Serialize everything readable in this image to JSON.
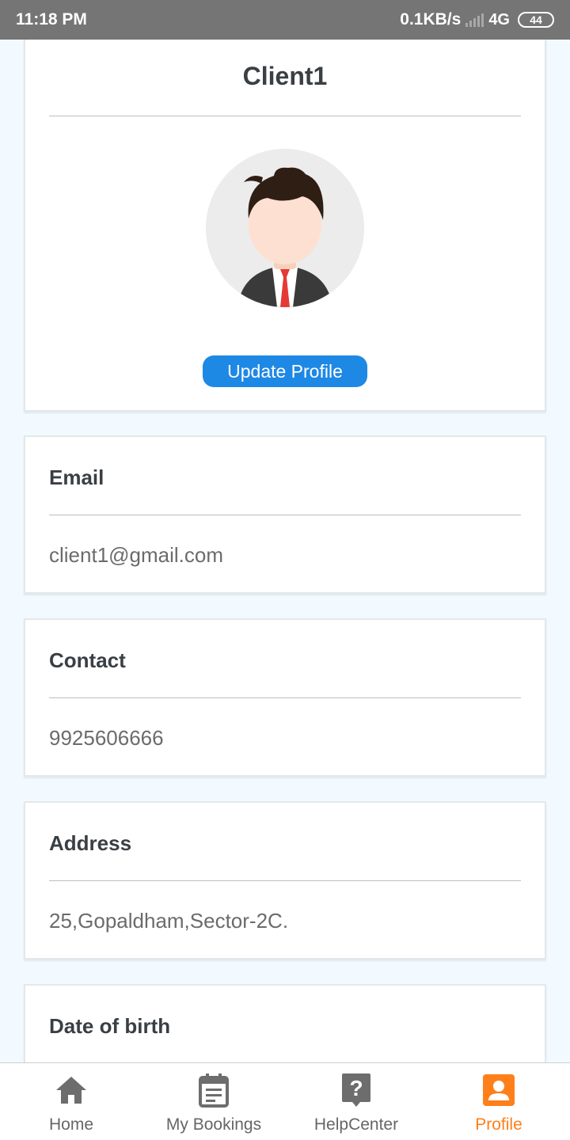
{
  "status_bar": {
    "time": "11:18 PM",
    "speed": "0.1KB/s",
    "network": "4G",
    "battery": "44"
  },
  "profile": {
    "name": "Client1",
    "update_button": "Update Profile"
  },
  "fields": {
    "email": {
      "label": "Email",
      "value": "client1@gmail.com"
    },
    "contact": {
      "label": "Contact",
      "value": "9925606666"
    },
    "address": {
      "label": "Address",
      "value": "25,Gopaldham,Sector-2C."
    },
    "dob": {
      "label": "Date of birth"
    }
  },
  "nav": {
    "home": {
      "label": "Home",
      "icon": "home-icon"
    },
    "bookings": {
      "label": "My Bookings",
      "icon": "calendar-icon"
    },
    "help": {
      "label": "HelpCenter",
      "icon": "help-icon"
    },
    "profile": {
      "label": "Profile",
      "icon": "profile-icon"
    },
    "active": "Profile"
  },
  "colors": {
    "accent": "#1e88e5",
    "active_tab": "#ff7f1a",
    "status_bar": "#757575"
  }
}
